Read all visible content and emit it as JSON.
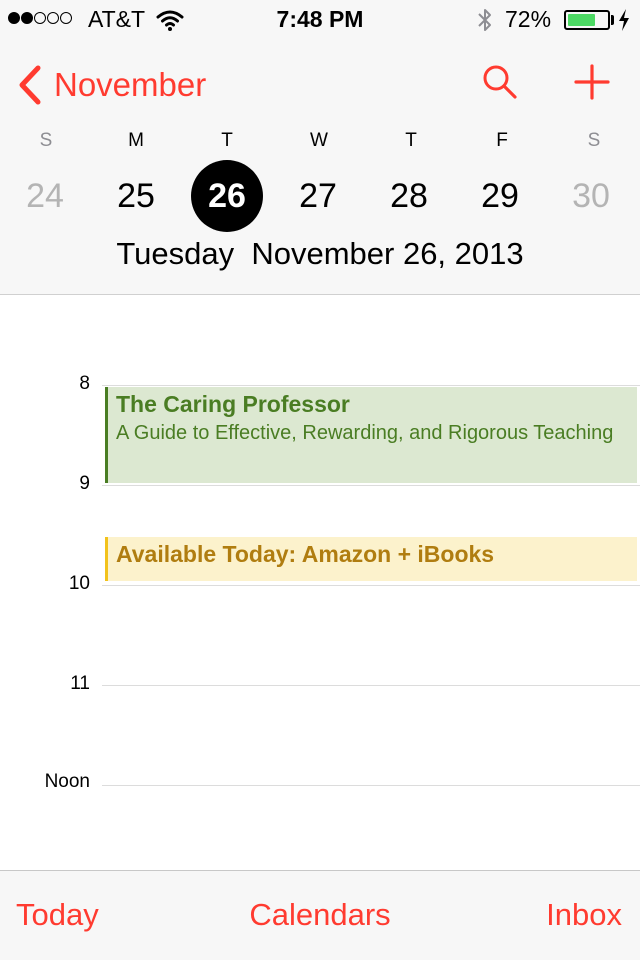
{
  "status_bar": {
    "signal_filled": 2,
    "signal_total": 5,
    "carrier": "AT&T",
    "time": "7:48 PM",
    "battery_percent": "72%",
    "battery_level": 0.72,
    "battery_color": "#4cd964"
  },
  "header": {
    "back_label": "November",
    "accent_color": "#ff3b30",
    "weekdays": [
      "S",
      "M",
      "T",
      "W",
      "T",
      "F",
      "S"
    ],
    "dates": [
      "24",
      "25",
      "26",
      "27",
      "28",
      "29",
      "30"
    ],
    "selected_index": 2,
    "full_date_day": "Tuesday",
    "full_date_rest": "November 26, 2013"
  },
  "timeline": {
    "hours": [
      "8",
      "9",
      "10",
      "11",
      "Noon"
    ],
    "events": [
      {
        "title": "The Caring Professor",
        "subtitle": "A Guide to Effective, Rewarding, and Rigorous Teaching",
        "color": "#4a7d23",
        "background": "#dce8d1"
      },
      {
        "title": "Available Today: Amazon + iBooks",
        "color": "#b07d10",
        "background": "#fcf2cc"
      }
    ]
  },
  "toolbar": {
    "today_label": "Today",
    "calendars_label": "Calendars",
    "inbox_label": "Inbox"
  }
}
